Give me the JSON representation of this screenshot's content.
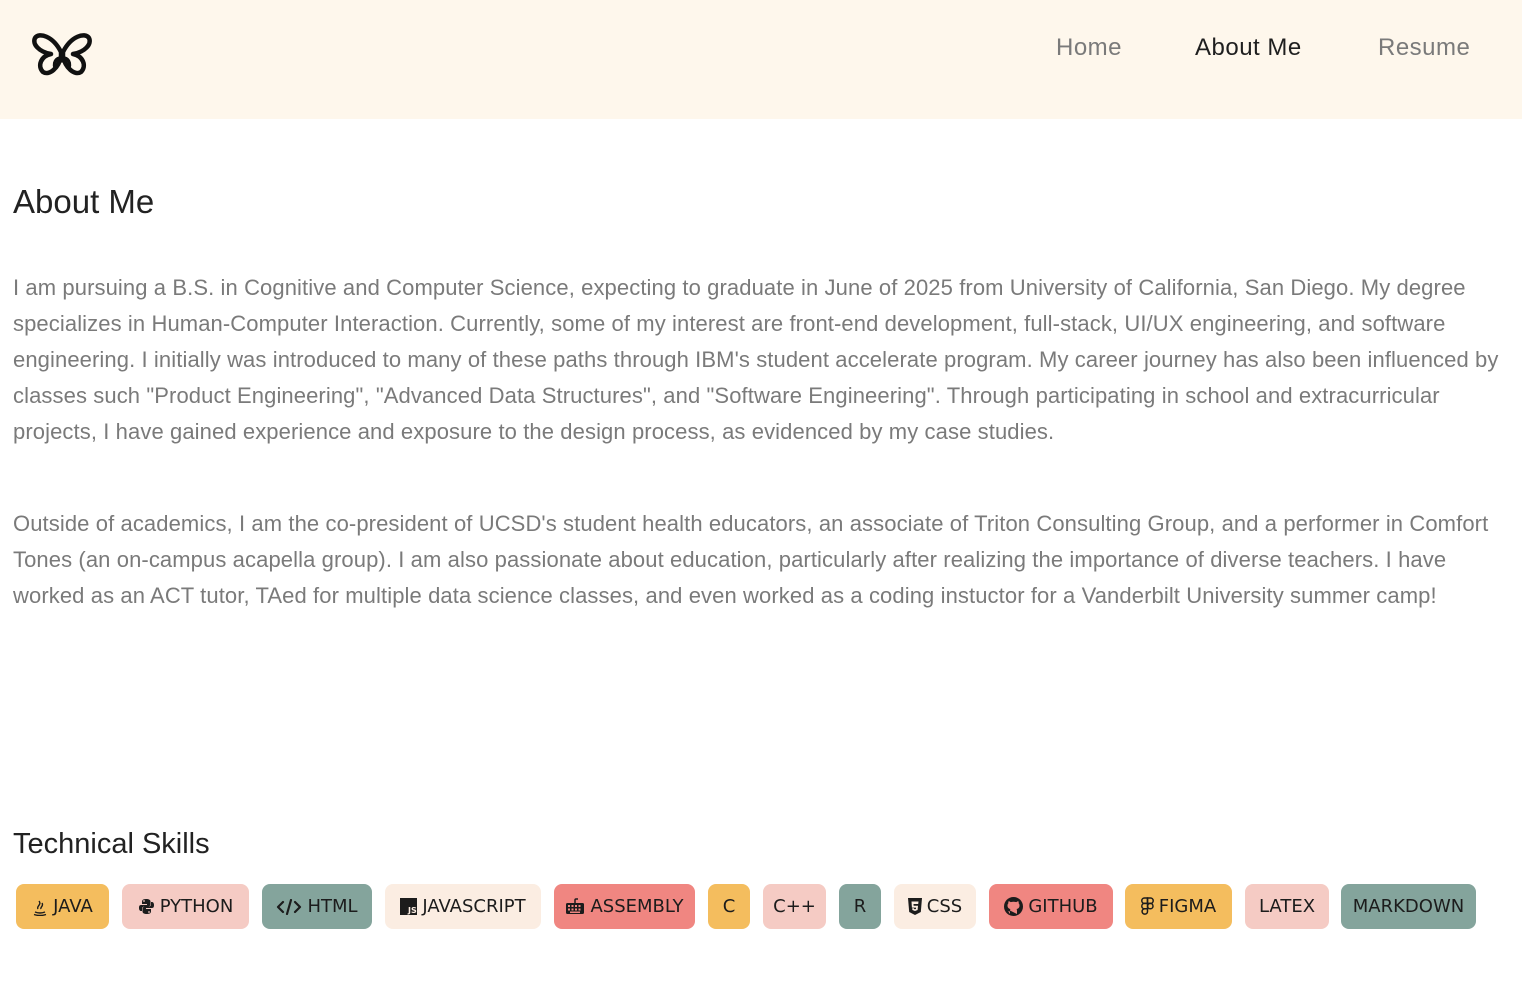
{
  "nav": {
    "logo_icon": "butterfly-icon",
    "links": [
      {
        "label": "Home",
        "active": false
      },
      {
        "label": "About Me",
        "active": true
      },
      {
        "label": "Resume",
        "active": false
      }
    ]
  },
  "about": {
    "heading": "About Me",
    "paragraphs": [
      "I am pursuing a B.S. in Cognitive and Computer Science, expecting to graduate in June of 2025 from University of California, San Diego. My degree specializes in Human-Computer Interaction. Currently, some of my interest are front-end development, full-stack, UI/UX engineering, and software engineering. I initially was introduced to many of these paths through IBM's student accelerate program. My career journey has also been influenced by classes such \"Product Engineering\", \"Advanced Data Structures\", and \"Software Engineering\". Through participating in school and extracurricular projects, I have gained experience and exposure to the design process, as evidenced by my case studies.",
      "Outside of academics, I am the co-president of UCSD's student health educators, an associate of Triton Consulting Group, and a performer in Comfort Tones (an on-campus acapella group). I am also passionate about education, particularly after realizing the importance of diverse teachers. I have worked as an ACT tutor, TAed for multiple data science classes, and even worked as a coding instuctor for a Vanderbilt University summer camp!"
    ]
  },
  "skills": {
    "heading": "Technical Skills",
    "colors": {
      "yellow": "#f4bd5e",
      "pink": "#f5cbc4",
      "teal": "#84a49c",
      "cream": "#fbede2",
      "red": "#f08681"
    },
    "items": [
      {
        "label": "JAVA",
        "icon": "java-icon",
        "color": "yellow"
      },
      {
        "label": "PYTHON",
        "icon": "python-icon",
        "color": "pink"
      },
      {
        "label": "HTML",
        "icon": "code-icon",
        "color": "teal"
      },
      {
        "label": "JAVASCRIPT",
        "icon": "javascript-icon",
        "color": "cream"
      },
      {
        "label": "ASSEMBLY",
        "icon": "keyboard-icon",
        "color": "red"
      },
      {
        "label": "C",
        "icon": "",
        "color": "yellow"
      },
      {
        "label": "C++",
        "icon": "",
        "color": "pink"
      },
      {
        "label": "R",
        "icon": "",
        "color": "teal"
      },
      {
        "label": "CSS",
        "icon": "css-icon",
        "color": "cream"
      },
      {
        "label": "GITHUB",
        "icon": "github-icon",
        "color": "red"
      },
      {
        "label": "FIGMA",
        "icon": "figma-icon",
        "color": "yellow"
      },
      {
        "label": "LATEX",
        "icon": "",
        "color": "pink"
      },
      {
        "label": "MARKDOWN",
        "icon": "",
        "color": "teal"
      }
    ]
  }
}
